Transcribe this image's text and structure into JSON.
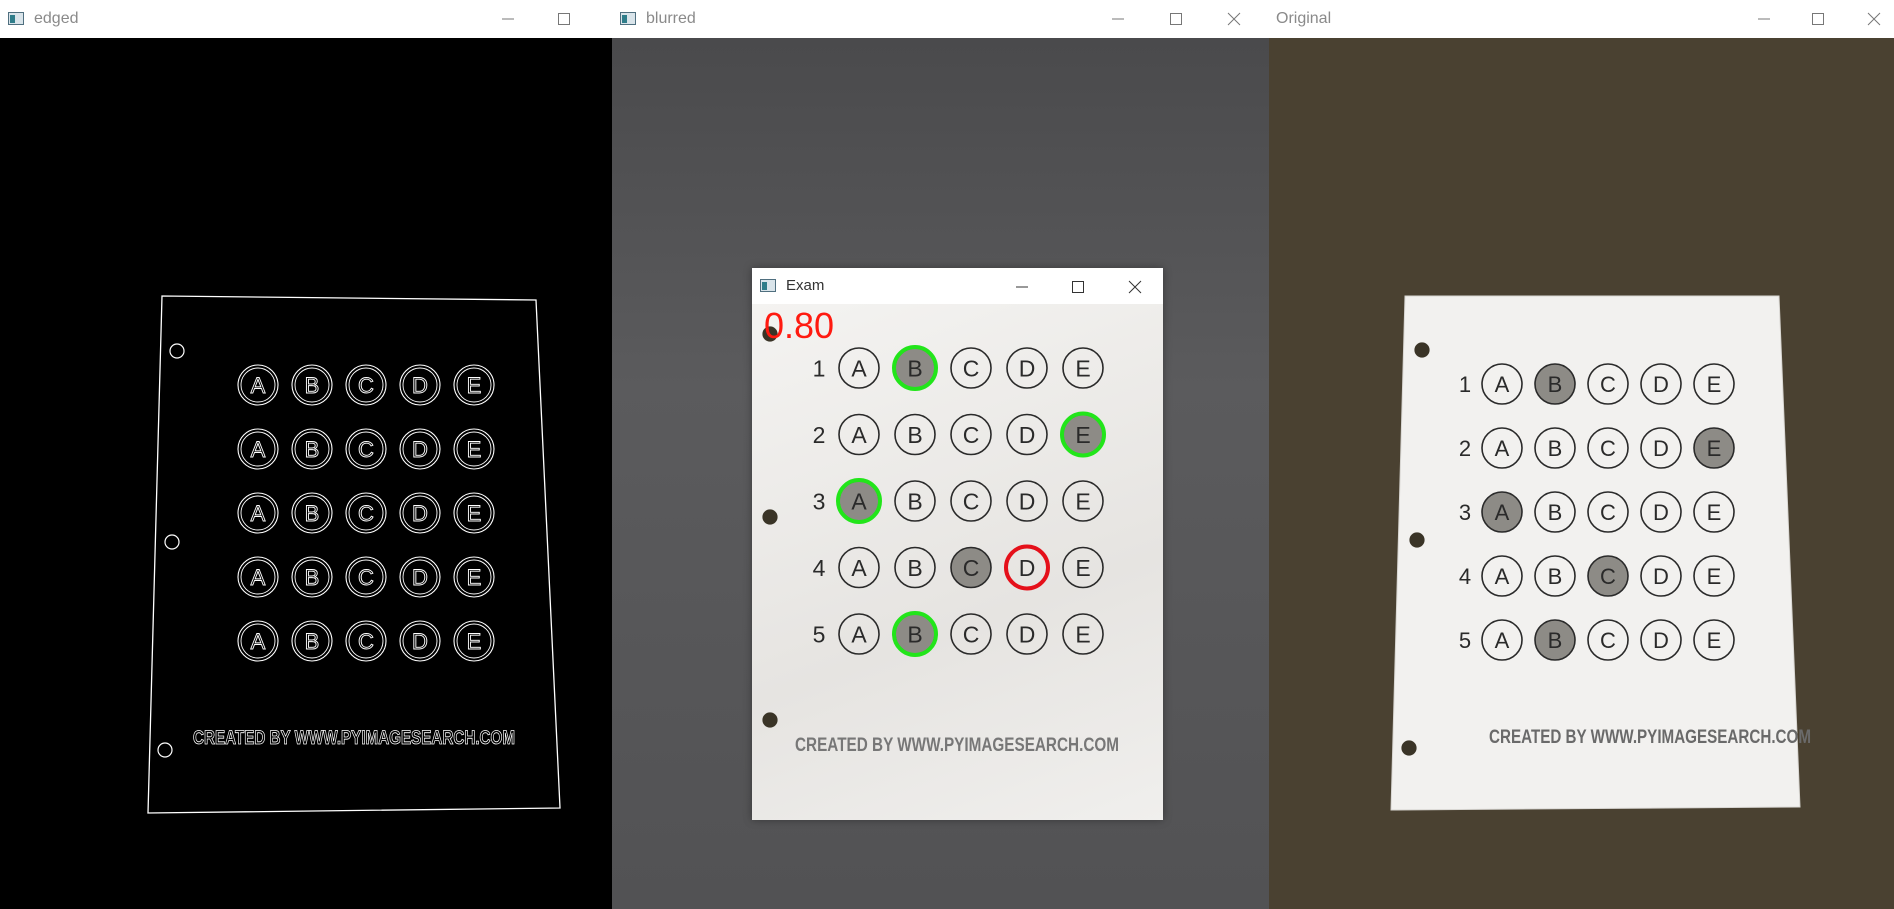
{
  "windows": {
    "edged": {
      "title": "edged"
    },
    "blurred": {
      "title": "blurred"
    },
    "original": {
      "title": "Original"
    },
    "exam": {
      "title": "Exam",
      "score": "0.80"
    }
  },
  "sheet": {
    "rows": [
      {
        "number": "1",
        "choices": [
          "A",
          "B",
          "C",
          "D",
          "E"
        ],
        "filled": "B"
      },
      {
        "number": "2",
        "choices": [
          "A",
          "B",
          "C",
          "D",
          "E"
        ],
        "filled": "E"
      },
      {
        "number": "3",
        "choices": [
          "A",
          "B",
          "C",
          "D",
          "E"
        ],
        "filled": "A"
      },
      {
        "number": "4",
        "choices": [
          "A",
          "B",
          "C",
          "D",
          "E"
        ],
        "filled": "C"
      },
      {
        "number": "5",
        "choices": [
          "A",
          "B",
          "C",
          "D",
          "E"
        ],
        "filled": "B"
      }
    ],
    "footer": "CREATED BY WWW.PYIMAGESEARCH.COM"
  },
  "grading": {
    "correct_marks": [
      {
        "row": "1",
        "choice": "B"
      },
      {
        "row": "2",
        "choice": "E"
      },
      {
        "row": "3",
        "choice": "A"
      },
      {
        "row": "5",
        "choice": "B"
      }
    ],
    "wrong_marks": [
      {
        "row": "4",
        "choice": "D"
      }
    ]
  },
  "colors": {
    "correct": "#22e51a",
    "wrong": "#e5101a",
    "score": "#ff1a10",
    "edged_bg": "#000000",
    "blurred_bg": "#58585a",
    "original_bg": "#4a4131",
    "paper": "#f2f1ef"
  },
  "icons": {
    "window_icon": "app-window-icon",
    "minimize": "minimize-icon",
    "maximize": "maximize-icon",
    "close": "close-icon"
  }
}
